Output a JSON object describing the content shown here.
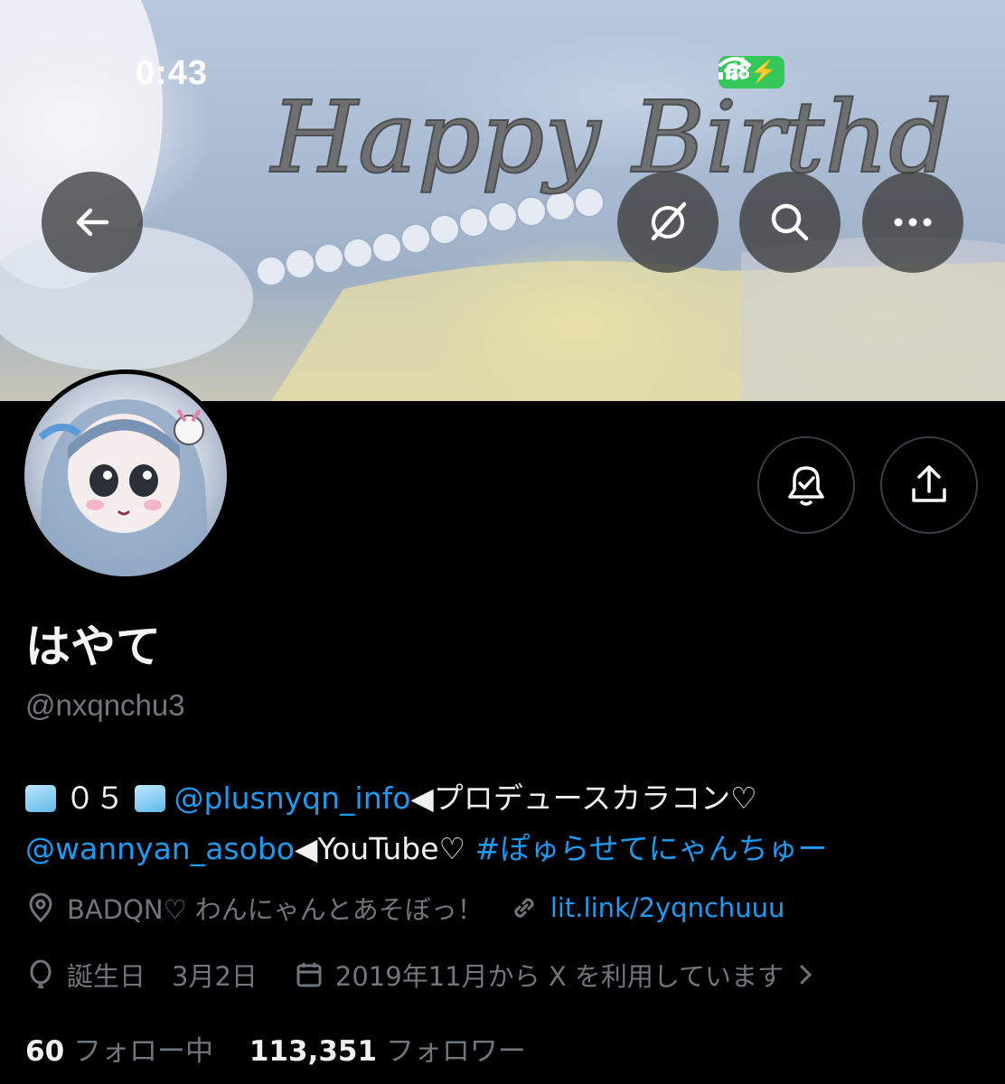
{
  "status_bar": {
    "time": "0:43",
    "battery": "98"
  },
  "banner": {
    "cake_text": "Happy Birthd"
  },
  "header_buttons": {
    "back_icon": "arrow-left-icon",
    "grok_icon": "grok-icon",
    "search_icon": "search-icon",
    "more_icon": "more-icon"
  },
  "profile": {
    "name": "はやて",
    "handle": "@nxqnchu3",
    "bio": {
      "line1_num": "０５",
      "mention1": "@plusnyqn_info",
      "line1_after": "◀︎プロデュースカラコン♡",
      "mention2": "@wannyan_asobo",
      "line2_mid": "◀︎YouTube♡ ",
      "hashtag": "#ぽゅらせてにゃんちゅー"
    },
    "location": "BADQN♡ わんにゃんとあそぼっ！",
    "website": "lit.link/2yqnchuuu",
    "birthday": "誕生日　3月2日",
    "joined": "2019年11月から X を利用しています",
    "following_count": "60",
    "following_label": "フォロー中",
    "followers_count": "113,351",
    "followers_label": "フォロワー"
  },
  "colors": {
    "accent": "#1d9bf0",
    "muted": "#71767b",
    "background": "#000000",
    "battery": "#34c759"
  }
}
